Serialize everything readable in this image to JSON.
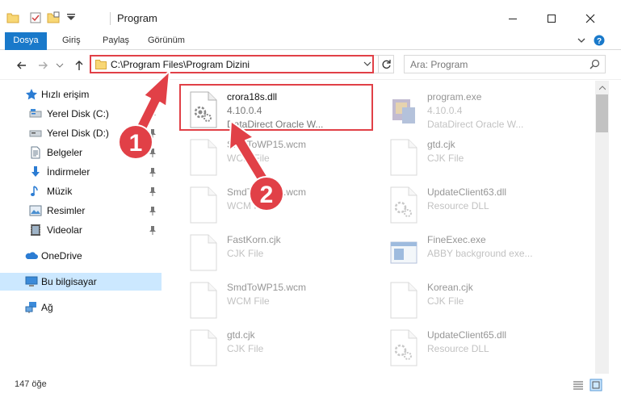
{
  "window": {
    "title": "Program"
  },
  "ribbon": {
    "tabs": [
      "Dosya",
      "Giriş",
      "Paylaş",
      "Görünüm"
    ]
  },
  "address": {
    "path": "C:\\Program Files\\Program Dizini"
  },
  "search": {
    "placeholder": "Ara: Program"
  },
  "navpane": {
    "quick_access": "Hızlı erişim",
    "items": [
      {
        "label": "Yerel Disk (C:)",
        "icon": "drive-icon"
      },
      {
        "label": "Yerel Disk (D:)",
        "icon": "drive-icon"
      },
      {
        "label": "Belgeler",
        "icon": "documents-icon"
      },
      {
        "label": "İndirmeler",
        "icon": "download-icon"
      },
      {
        "label": "Müzik",
        "icon": "music-icon"
      },
      {
        "label": "Resimler",
        "icon": "pictures-icon"
      },
      {
        "label": "Videolar",
        "icon": "videos-icon"
      }
    ],
    "onedrive": "OneDrive",
    "this_pc": "Bu bilgisayar",
    "network": "Ağ"
  },
  "files": [
    {
      "name": "crora18s.dll",
      "version": "4.10.0.4",
      "desc": "DataDirect Oracle W...",
      "icon": "dll-icon"
    },
    {
      "name": "program.exe",
      "version": "4.10.0.4",
      "desc": "DataDirect Oracle W...",
      "icon": "exe-icon"
    },
    {
      "name": "SmdToWP15.wcm",
      "version": "WCM File",
      "desc": "",
      "icon": "file-icon"
    },
    {
      "name": "gtd.cjk",
      "version": "CJK File",
      "desc": "",
      "icon": "file-icon"
    },
    {
      "name": "SmdToWP15.wcm",
      "version": "WCM File",
      "desc": "",
      "icon": "file-icon"
    },
    {
      "name": "UpdateClient63.dll",
      "version": "Resource DLL",
      "desc": "",
      "icon": "dll-icon"
    },
    {
      "name": "FastKorn.cjk",
      "version": "CJK File",
      "desc": "",
      "icon": "file-icon"
    },
    {
      "name": "FineExec.exe",
      "version": "ABBY background exe...",
      "desc": "",
      "icon": "exe-icon"
    },
    {
      "name": "SmdToWP15.wcm",
      "version": "WCM File",
      "desc": "",
      "icon": "file-icon"
    },
    {
      "name": "Korean.cjk",
      "version": "CJK File",
      "desc": "",
      "icon": "file-icon"
    },
    {
      "name": "gtd.cjk",
      "version": "CJK File",
      "desc": "",
      "icon": "file-icon"
    },
    {
      "name": "UpdateClient65.dll",
      "version": "Resource DLL",
      "desc": "",
      "icon": "dll-icon"
    }
  ],
  "status": {
    "count": "147 öğe"
  },
  "annotations": [
    {
      "number": "1"
    },
    {
      "number": "2"
    }
  ],
  "colors": {
    "accent": "#1979ca",
    "annotation_red": "#e14047",
    "selection": "#cce8ff"
  }
}
